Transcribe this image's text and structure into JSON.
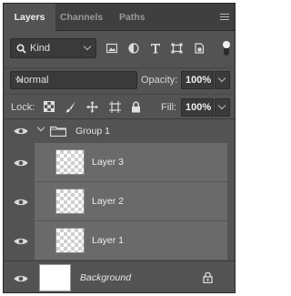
{
  "tabs": [
    {
      "label": "Layers",
      "active": true
    },
    {
      "label": "Channels",
      "active": false
    },
    {
      "label": "Paths",
      "active": false
    }
  ],
  "filter": {
    "kind_label": "Kind",
    "icons": [
      "image-filter-icon",
      "adjustment-filter-icon",
      "type-filter-icon",
      "shape-filter-icon",
      "smart-object-filter-icon",
      "filter-toggle-icon"
    ]
  },
  "blend": {
    "mode": "Normal",
    "opacity_label": "Opacity:",
    "opacity_value": "100%"
  },
  "lock": {
    "label": "Lock:",
    "icons": [
      "lock-transparent-pixels-icon",
      "lock-image-pixels-icon",
      "lock-position-icon",
      "lock-artboard-icon",
      "lock-all-icon"
    ],
    "fill_label": "Fill:",
    "fill_value": "100%"
  },
  "layers": {
    "group": {
      "name": "Group 1",
      "expanded": true,
      "visible": true
    },
    "items": [
      {
        "name": "Layer 3",
        "visible": true
      },
      {
        "name": "Layer 2",
        "visible": true
      },
      {
        "name": "Layer 1",
        "visible": true
      }
    ],
    "background": {
      "name": "Background",
      "locked": true,
      "visible": true
    }
  },
  "colors": {
    "panel_bg": "#535353",
    "tabbar_bg": "#3f3f3f",
    "field_bg": "#3a3a3a",
    "group_child_bg": "#6a6a6a"
  }
}
